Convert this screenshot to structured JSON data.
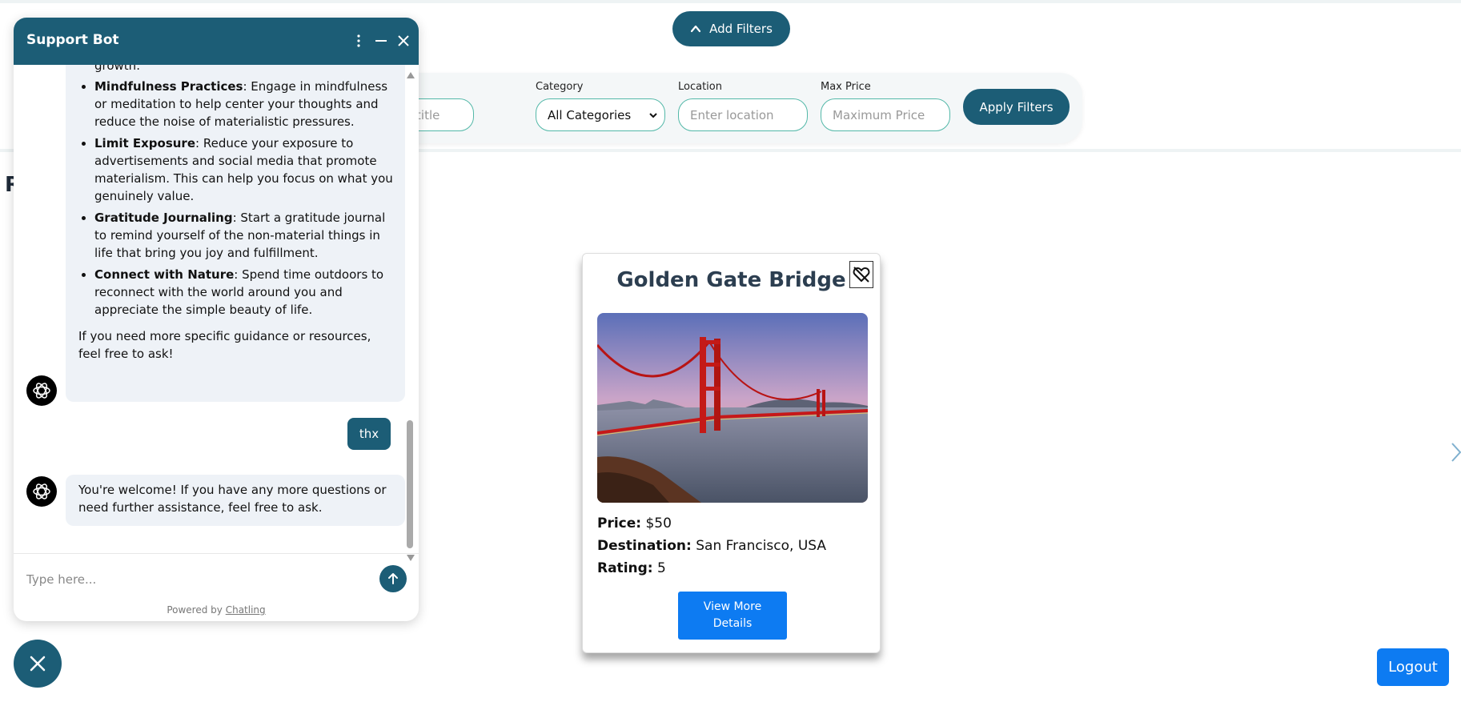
{
  "filters": {
    "toggle_label": "Add Filters",
    "title_placeholder": "Enter title",
    "category_label": "Category",
    "category_value": "All Categories",
    "location_label": "Location",
    "location_placeholder": "Enter location",
    "max_price_label": "Max Price",
    "max_price_placeholder": "Maximum Price",
    "apply_label": "Apply Filters"
  },
  "section": {
    "heading_partial": "R"
  },
  "card": {
    "title": "Golden Gate Bridge",
    "price_label": "Price:",
    "price_value": "$50",
    "destination_label": "Destination:",
    "destination_value": "San Francisco, USA",
    "rating_label": "Rating:",
    "rating_value": "5",
    "details_label_1": "View More",
    "details_label_2": "Details"
  },
  "logout_label": "Logout",
  "chat": {
    "title": "Support Bot",
    "top_fragment": "growth.",
    "tips": [
      {
        "term": "Mindfulness Practices",
        "text": ": Engage in mindfulness or meditation to help center your thoughts and reduce the noise of materialistic pressures."
      },
      {
        "term": "Limit Exposure",
        "text": ": Reduce your exposure to advertisements and social media that promote materialism. This can help you focus on what you genuinely value."
      },
      {
        "term": "Gratitude Journaling",
        "text": ": Start a gratitude journal to remind yourself of the non-material things in life that bring you joy and fulfillment."
      },
      {
        "term": "Connect with Nature",
        "text": ": Spend time outdoors to reconnect with the world around you and appreciate the simple beauty of life."
      }
    ],
    "closing": "If you need more specific guidance or resources, feel free to ask!",
    "user_message": "thx",
    "bot_reply": "You're welcome! If you have any more questions or need further assistance, feel free to ask.",
    "input_placeholder": "Type here...",
    "powered_prefix": "Powered by",
    "powered_link": "Chatling"
  },
  "colors": {
    "brand": "#1c5d76",
    "primary_button": "#0d7bf2",
    "input_border": "#53b8a8"
  }
}
